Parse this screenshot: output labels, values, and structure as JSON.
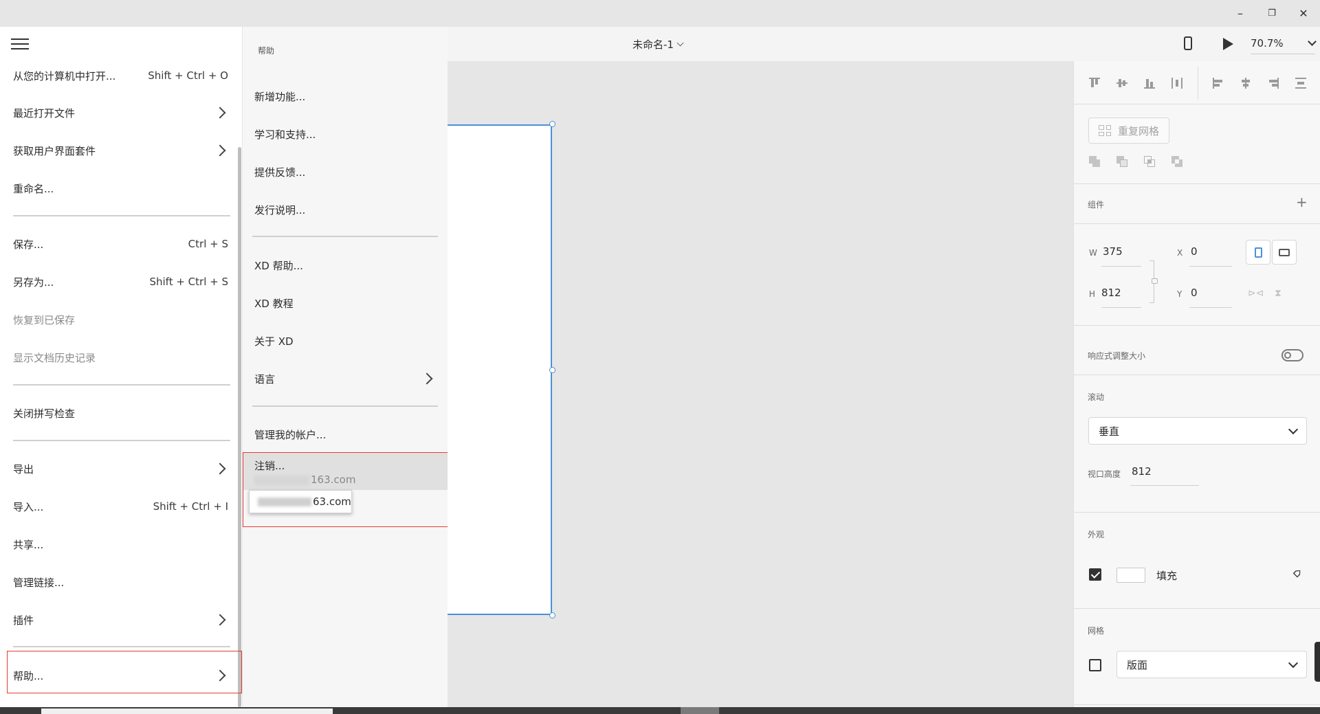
{
  "window": {
    "minimize": "–",
    "restore": "❐",
    "close": "✕"
  },
  "left_menu": {
    "items": [
      {
        "label": "从您的计算机中打开...",
        "shortcut": "Shift + Ctrl + O"
      },
      {
        "label": "最近打开文件",
        "shortcut": ""
      },
      {
        "label": "获取用户界面套件",
        "shortcut": ""
      },
      {
        "label": "重命名...",
        "shortcut": ""
      },
      {
        "label": "保存...",
        "shortcut": "Ctrl + S"
      },
      {
        "label": "另存为...",
        "shortcut": "Shift + Ctrl + S"
      },
      {
        "label": "恢复到已保存",
        "shortcut": ""
      },
      {
        "label": "显示文档历史记录",
        "shortcut": ""
      },
      {
        "label": "关闭拼写检查",
        "shortcut": ""
      },
      {
        "label": "导出",
        "shortcut": ""
      },
      {
        "label": "导入...",
        "shortcut": "Shift + Ctrl + I"
      },
      {
        "label": "共享...",
        "shortcut": ""
      },
      {
        "label": "管理链接...",
        "shortcut": ""
      },
      {
        "label": "插件",
        "shortcut": ""
      },
      {
        "label": "帮助...",
        "shortcut": ""
      }
    ]
  },
  "help_menu": {
    "title": "帮助",
    "items": [
      "新增功能...",
      "学习和支持...",
      "提供反馈...",
      "发行说明...",
      "XD 帮助...",
      "XD 教程",
      "关于 XD",
      "语言",
      "管理我的帐户..."
    ],
    "signout_label": "注销...",
    "signout_email": "163.com",
    "tooltip_email": "63.com"
  },
  "toolbar": {
    "doc_title": "未命名-1",
    "zoom": "70.7%"
  },
  "right_panel": {
    "repeat_grid": "重复网格",
    "component_label": "组件",
    "component_add": "+",
    "w_label": "W",
    "w_value": "375",
    "h_label": "H",
    "h_value": "812",
    "x_label": "X",
    "x_value": "0",
    "y_label": "Y",
    "y_value": "0",
    "responsive_label": "响应式调整大小",
    "scroll_label": "滚动",
    "scroll_value": "垂直",
    "viewport_label": "视口高度",
    "viewport_value": "812",
    "appearance_label": "外观",
    "fill_label": "填充",
    "grid_label": "网格",
    "grid_value": "版面"
  },
  "colors": {
    "accent": "#4a90d9",
    "highlight": "#e53935"
  }
}
